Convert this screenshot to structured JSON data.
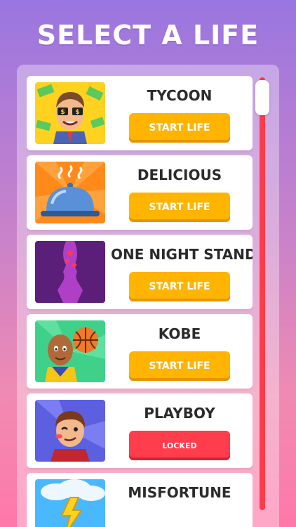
{
  "header": {
    "title": "SELECT A LIFE"
  },
  "lives": [
    {
      "title": "TYCOON",
      "button_label": "START LIFE",
      "status": "available",
      "image": "tycoon-icon"
    },
    {
      "title": "DELICIOUS",
      "button_label": "START LIFE",
      "status": "available",
      "image": "food-cloche-icon"
    },
    {
      "title": "ONE NIGHT STAND",
      "button_label": "START LIFE",
      "status": "available",
      "image": "kiss-icon"
    },
    {
      "title": "KOBE",
      "button_label": "START LIFE",
      "status": "available",
      "image": "basketball-player-icon"
    },
    {
      "title": "PLAYBOY",
      "button_label": "LOCKED",
      "status": "locked",
      "image": "playboy-icon"
    },
    {
      "title": "MISFORTUNE",
      "button_label": "",
      "status": "locked",
      "image": "lightning-cloud-icon"
    }
  ],
  "colors": {
    "start_button": "#ffb400",
    "locked_button": "#ff3d4c",
    "scrollbar": "#ff3b4a"
  }
}
